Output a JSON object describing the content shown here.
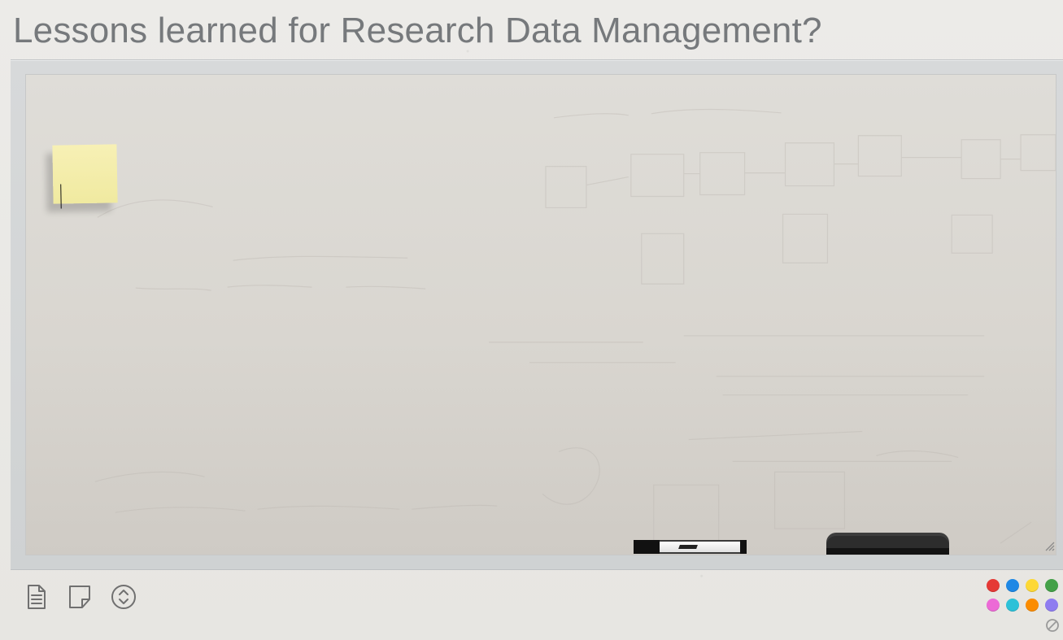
{
  "page": {
    "title": "Lessons learned for Research Data Management?"
  },
  "whiteboard": {
    "marker_label": "EXPO"
  },
  "toolbar": {
    "icons": [
      "text-document-icon",
      "sticky-note-icon",
      "up-down-icon"
    ]
  },
  "palette": {
    "colors": [
      "#e53935",
      "#1e88e5",
      "#fdd835",
      "#43a047",
      "#ec6ad6",
      "#2cc1d8",
      "#fb8c00",
      "#8e7cf0"
    ]
  },
  "actions": {
    "clear_icon": "clear-icon"
  }
}
